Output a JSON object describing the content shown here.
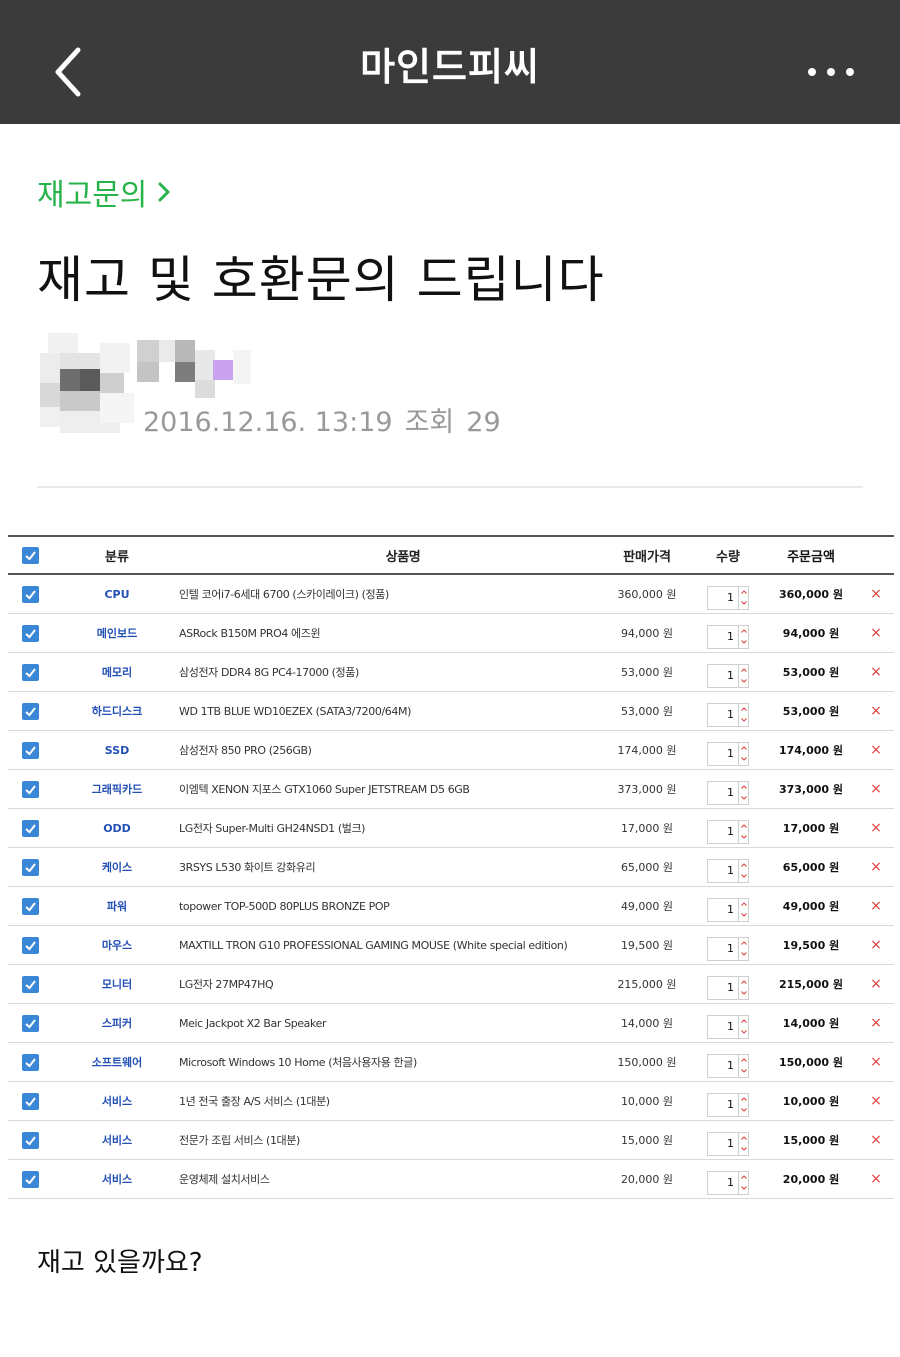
{
  "app": {
    "title": "마인드피씨"
  },
  "post": {
    "category": "재고문의",
    "title": "재고 및 호환문의 드립니다",
    "date": "2016.12.16. 13:19",
    "views_label": "조회",
    "views": "29",
    "body": "재고 있을까요?"
  },
  "cart": {
    "headers": {
      "category": "분류",
      "name": "상품명",
      "price": "판매가격",
      "qty": "수량",
      "amount": "주문금액"
    },
    "rows": [
      {
        "category": "CPU",
        "name": "인텔 코어i7-6세대 6700 (스카이레이크) (정품)",
        "price": "360,000 원",
        "qty": "1",
        "amount": "360,000 원"
      },
      {
        "category": "메인보드",
        "name": "ASRock B150M PRO4 에즈윈",
        "price": "94,000 원",
        "qty": "1",
        "amount": "94,000 원"
      },
      {
        "category": "메모리",
        "name": "삼성전자 DDR4 8G PC4-17000 (정품)",
        "price": "53,000 원",
        "qty": "1",
        "amount": "53,000 원"
      },
      {
        "category": "하드디스크",
        "name": "WD 1TB BLUE WD10EZEX (SATA3/7200/64M)",
        "price": "53,000 원",
        "qty": "1",
        "amount": "53,000 원"
      },
      {
        "category": "SSD",
        "name": "삼성전자 850 PRO (256GB)",
        "price": "174,000 원",
        "qty": "1",
        "amount": "174,000 원"
      },
      {
        "category": "그래픽카드",
        "name": "이엠텍 XENON 지포스 GTX1060 Super JETSTREAM D5 6GB",
        "price": "373,000 원",
        "qty": "1",
        "amount": "373,000 원"
      },
      {
        "category": "ODD",
        "name": "LG전자 Super-Multi GH24NSD1 (벌크)",
        "price": "17,000 원",
        "qty": "1",
        "amount": "17,000 원"
      },
      {
        "category": "케이스",
        "name": "3RSYS L530 화이트 강화유리",
        "price": "65,000 원",
        "qty": "1",
        "amount": "65,000 원"
      },
      {
        "category": "파워",
        "name": "topower TOP-500D 80PLUS BRONZE POP",
        "price": "49,000 원",
        "qty": "1",
        "amount": "49,000 원"
      },
      {
        "category": "마우스",
        "name": "MAXTILL TRON G10 PROFESSIONAL GAMING MOUSE (White special edition)",
        "price": "19,500 원",
        "qty": "1",
        "amount": "19,500 원"
      },
      {
        "category": "모니터",
        "name": "LG전자 27MP47HQ",
        "price": "215,000 원",
        "qty": "1",
        "amount": "215,000 원"
      },
      {
        "category": "스피커",
        "name": "Meic Jackpot X2 Bar Speaker",
        "price": "14,000 원",
        "qty": "1",
        "amount": "14,000 원"
      },
      {
        "category": "소프트웨어",
        "name": "Microsoft Windows 10 Home (처음사용자용 한글)",
        "price": "150,000 원",
        "qty": "1",
        "amount": "150,000 원"
      },
      {
        "category": "서비스",
        "name": "1년 전국 출장 A/S 서비스 (1대분)",
        "price": "10,000 원",
        "qty": "1",
        "amount": "10,000 원"
      },
      {
        "category": "서비스",
        "name": "전문가 조립 서비스 (1대분)",
        "price": "15,000 원",
        "qty": "1",
        "amount": "15,000 원"
      },
      {
        "category": "서비스",
        "name": "운영체제 설치서비스",
        "price": "20,000 원",
        "qty": "1",
        "amount": "20,000 원"
      }
    ]
  },
  "colors": {
    "topbar": "#3b3b3b",
    "category": "#27b34a",
    "checkbox": "#3a87d8",
    "category_text": "#2350b5",
    "delete": "#e23a3a"
  },
  "icons": {
    "back": "chevron-left-icon",
    "more": "more-dots-icon",
    "category_arrow": "chevron-right-icon",
    "check": "checkbox-checked-icon",
    "delete": "close-x-icon"
  },
  "delete_glyph": "×"
}
